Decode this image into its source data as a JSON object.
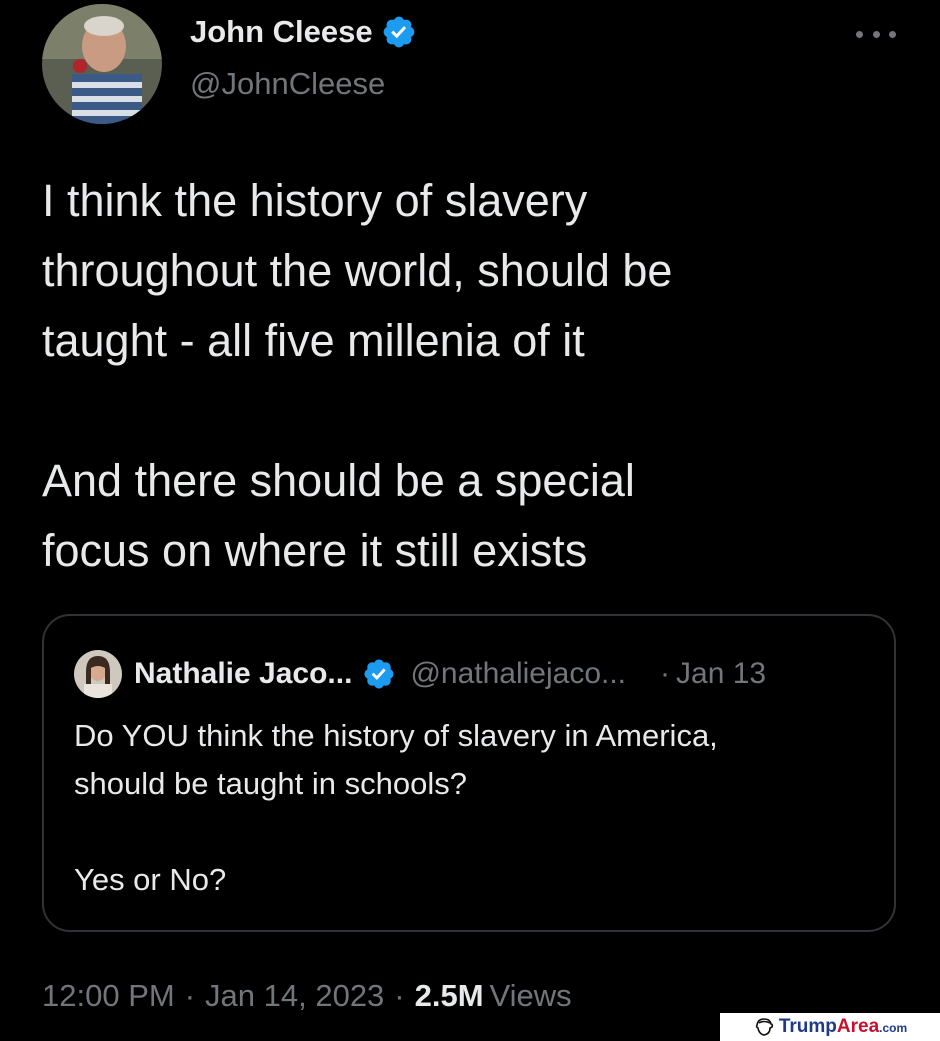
{
  "tweet": {
    "author": {
      "name": "John Cleese",
      "handle": "@JohnCleese",
      "verified": true
    },
    "text_lines": [
      "I think the history of slavery",
      "throughout the world, should be",
      "taught - all five millenia of it",
      "And there should be a special",
      "focus on where it still exists"
    ],
    "more_icon": "more-horizontal-icon"
  },
  "quoted_tweet": {
    "author": {
      "name": "Nathalie Jaco...",
      "handle": "@nathaliejaco...",
      "verified": true
    },
    "separator": "·",
    "date": "Jan 13",
    "text_lines": [
      "Do YOU think the history of slavery in America,",
      "should be taught in schools?",
      "Yes or No?"
    ]
  },
  "meta": {
    "time": "12:00 PM",
    "separator": "·",
    "date": "Jan 14, 2023",
    "views_count": "2.5M",
    "views_label": "Views"
  },
  "watermark": {
    "brand": "TrumpArea",
    "suffix": ".com"
  },
  "colors": {
    "background": "#000000",
    "text": "#e7e9ea",
    "secondary_text": "#71767b",
    "verified_badge": "#1d9bf0",
    "border": "#2f3336"
  }
}
